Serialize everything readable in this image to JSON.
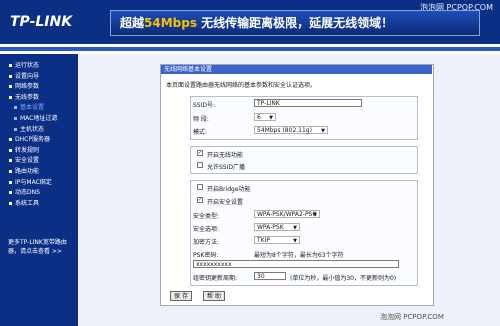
{
  "header": {
    "logo": "TP-LINK",
    "watermark": "泡泡网 PCPOP.COM",
    "slogan_pre": "超越",
    "slogan_highlight": "54Mbps",
    "slogan_post": " 无线传输距离极限，延展无线领域！"
  },
  "sidebar": {
    "items": [
      {
        "label": "运行状态",
        "sub": false,
        "active": false
      },
      {
        "label": "设置向导",
        "sub": false,
        "active": false
      },
      {
        "label": "网络参数",
        "sub": false,
        "active": false
      },
      {
        "label": "无线参数",
        "sub": false,
        "active": false
      },
      {
        "label": "基本设置",
        "sub": true,
        "active": true
      },
      {
        "label": "MAC地址过滤",
        "sub": true,
        "active": false
      },
      {
        "label": "主机状态",
        "sub": true,
        "active": false
      },
      {
        "label": "DHCP服务器",
        "sub": false,
        "active": false
      },
      {
        "label": "转发规则",
        "sub": false,
        "active": false
      },
      {
        "label": "安全设置",
        "sub": false,
        "active": false
      },
      {
        "label": "路由功能",
        "sub": false,
        "active": false
      },
      {
        "label": "IP与MAC绑定",
        "sub": false,
        "active": false
      },
      {
        "label": "动态DNS",
        "sub": false,
        "active": false
      },
      {
        "label": "系统工具",
        "sub": false,
        "active": false
      }
    ],
    "more_line1": "更多TP-LINK宽带路由",
    "more_line2": "器，请点击查看 >>"
  },
  "panel": {
    "title": "无线网络基本设置",
    "intro": "本页面设置路由器无线网络的基本参数和安全认证选项。",
    "ssid_label": "SSID号:",
    "ssid_value": "TP-LINK",
    "channel_label": "频 段:",
    "channel_value": "6",
    "mode_label": "模式:",
    "mode_value": "54Mbps (802.11g)",
    "enable_wireless": "开启无线功能",
    "allow_ssid": "允许SSID广播",
    "enable_bridge": "开启Bridge功能",
    "enable_security": "开启安全设置",
    "security_type_label": "安全类型:",
    "security_type_value": "WPA-PSK/WPA2-PSK",
    "security_option_label": "安全选项:",
    "security_option_value": "WPA-PSK",
    "encryption_label": "加密方法:",
    "encryption_value": "TKIP",
    "psk_label": "PSK密码:",
    "psk_hint": "最短为8个字符，最长为63个字符",
    "psk_value": "xxxxxxxxxx",
    "group_key_label": "组密钥更新周期:",
    "group_key_value": "30",
    "group_key_hint": "(单位为秒，最小值为30，不更新则为0)",
    "save": "保 存",
    "help": "帮 助"
  },
  "footer_watermark": "泡泡网 PCPOP.COM",
  "checks": {
    "enable_wireless": "✓",
    "enable_security": "✓"
  }
}
